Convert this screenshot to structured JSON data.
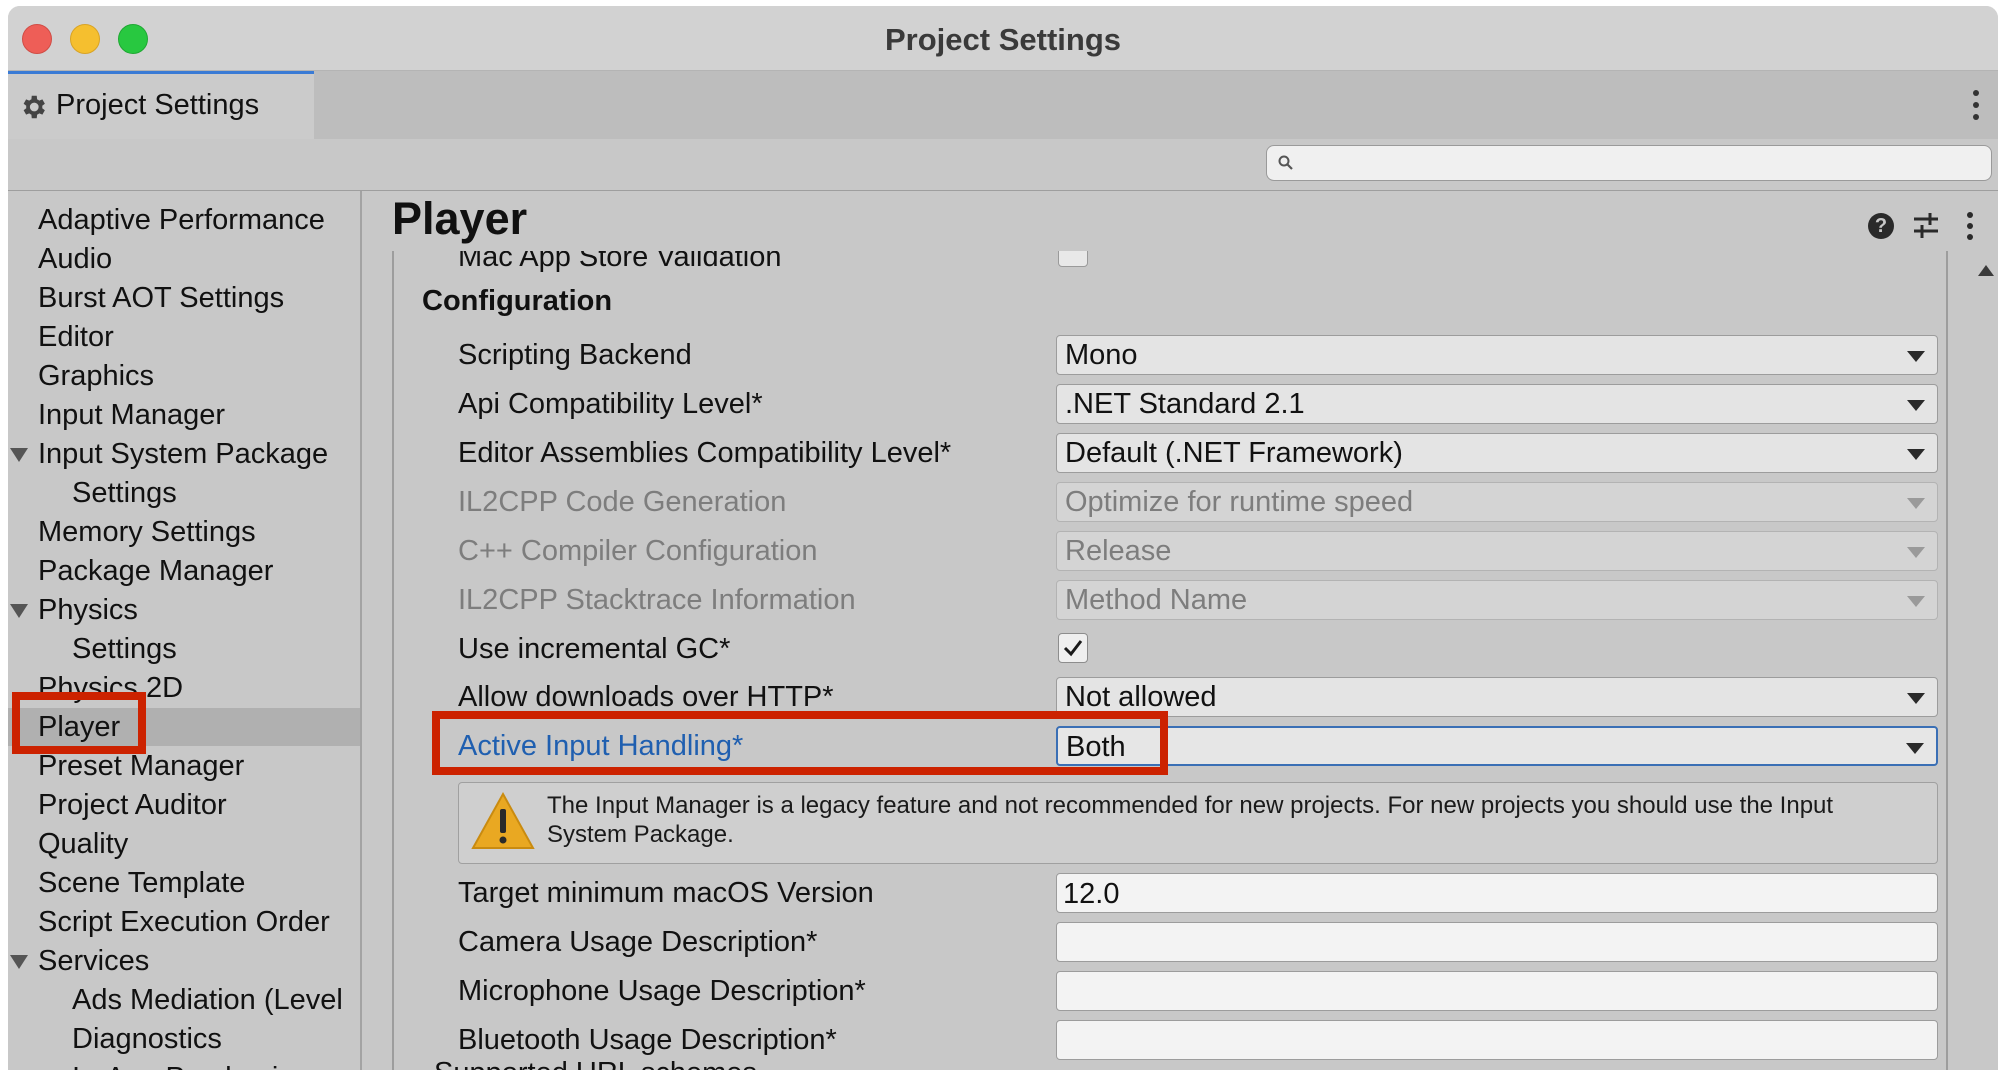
{
  "window": {
    "title": "Project Settings"
  },
  "tab": {
    "label": "Project Settings",
    "icon": "gear-icon"
  },
  "search": {
    "placeholder": "",
    "value": ""
  },
  "sidebar": {
    "items": [
      {
        "label": "Adaptive Performance"
      },
      {
        "label": "Audio"
      },
      {
        "label": "Burst AOT Settings"
      },
      {
        "label": "Editor"
      },
      {
        "label": "Graphics"
      },
      {
        "label": "Input Manager"
      },
      {
        "label": "Input System Package",
        "expanded": true
      },
      {
        "label": "Settings"
      },
      {
        "label": "Memory Settings"
      },
      {
        "label": "Package Manager"
      },
      {
        "label": "Physics",
        "expanded": true
      },
      {
        "label": "Settings"
      },
      {
        "label": "Physics 2D"
      },
      {
        "label": "Player",
        "selected": true
      },
      {
        "label": "Preset Manager"
      },
      {
        "label": "Project Auditor"
      },
      {
        "label": "Quality"
      },
      {
        "label": "Scene Template"
      },
      {
        "label": "Script Execution Order"
      },
      {
        "label": "Services",
        "expanded": true
      },
      {
        "label": "Ads Mediation (Level"
      },
      {
        "label": "Diagnostics"
      },
      {
        "label": "In-App Purchasing"
      }
    ]
  },
  "main": {
    "title": "Player",
    "clipped_label": "Mac App Store Validation",
    "section": "Configuration",
    "rows": {
      "scripting_backend": {
        "label": "Scripting Backend",
        "value": "Mono"
      },
      "api_compat": {
        "label": "Api Compatibility Level*",
        "value": ".NET Standard 2.1"
      },
      "editor_assemblies": {
        "label": "Editor Assemblies Compatibility Level*",
        "value": "Default (.NET Framework)"
      },
      "il2cpp_codegen": {
        "label": "IL2CPP Code Generation",
        "value": "Optimize for runtime speed"
      },
      "cpp_compiler": {
        "label": "C++ Compiler Configuration",
        "value": "Release"
      },
      "il2cpp_stacktrace": {
        "label": "IL2CPP Stacktrace Information",
        "value": "Method Name"
      },
      "incremental_gc": {
        "label": "Use incremental GC*",
        "checked": true
      },
      "allow_http": {
        "label": "Allow downloads over HTTP*",
        "value": "Not allowed"
      },
      "active_input": {
        "label": "Active Input Handling*",
        "value": "Both"
      },
      "target_macos": {
        "label": "Target minimum macOS Version",
        "value": "12.0"
      },
      "camera_usage": {
        "label": "Camera Usage Description*",
        "value": ""
      },
      "mic_usage": {
        "label": "Microphone Usage Description*",
        "value": ""
      },
      "bluetooth_usage": {
        "label": "Bluetooth Usage Description*",
        "value": ""
      }
    },
    "warning": "The Input Manager is a legacy feature and not recommended for new projects. For new projects you should use the Input System Package.",
    "cut_row": "Supported URL schemes"
  },
  "colors": {
    "highlight": "#cc2200",
    "accent": "#3a7bd5",
    "active_label": "#1f5fb0"
  }
}
